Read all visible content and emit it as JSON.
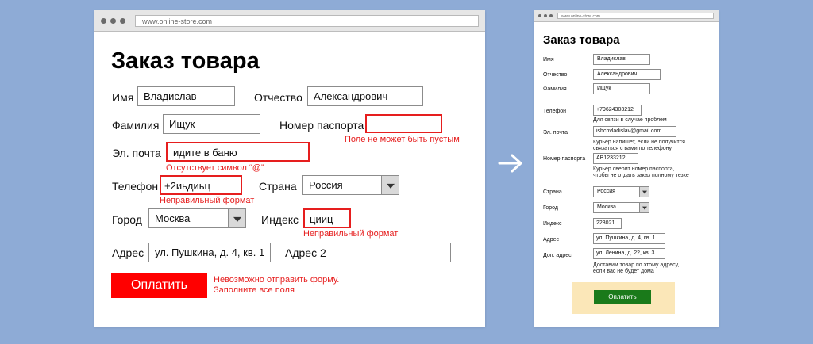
{
  "left_window": {
    "url": "www.online-store.com",
    "title": "Заказ товара",
    "fields": {
      "name": {
        "label": "Имя",
        "value": "Владислав"
      },
      "patronymic": {
        "label": "Отчество",
        "value": "Александрович"
      },
      "surname": {
        "label": "Фамилия",
        "value": "Ищук"
      },
      "passport": {
        "label": "Номер паспорта",
        "value": "",
        "error": "Поле не может быть пустым"
      },
      "email": {
        "label": "Эл. почта",
        "value": "идите в баню",
        "error": "Отсутствует символ “@”"
      },
      "phone": {
        "label": "Телефон",
        "value": "+2иьдиьц",
        "error": "Неправильный формат"
      },
      "country": {
        "label": "Страна",
        "value": "Россия"
      },
      "city": {
        "label": "Город",
        "value": "Москва"
      },
      "zip": {
        "label": "Индекс",
        "value": "цииц",
        "error": "Неправильный формат"
      },
      "address": {
        "label": "Адрес",
        "value": "ул. Пушкина, д. 4, кв. 1"
      },
      "address2": {
        "label": "Адрес 2",
        "value": ""
      }
    },
    "submit_label": "Оплатить",
    "submit_error_1": "Невозможно отправить форму.",
    "submit_error_2": "Заполните все поля"
  },
  "right_window": {
    "url": "www.online-store.com",
    "title": "Заказ товара",
    "fields": {
      "name": {
        "label": "Имя",
        "value": "Владислав"
      },
      "patronymic": {
        "label": "Отчество",
        "value": "Александрович"
      },
      "surname": {
        "label": "Фамилия",
        "value": "Ищук"
      },
      "phone": {
        "label": "Телефон",
        "value": "+79624303212",
        "hint": "Для связи в случае проблем"
      },
      "email": {
        "label": "Эл. почта",
        "value": "ishchvladislav@gmail.com",
        "hint_1": "Курьер напишет, если не получится",
        "hint_2": "связаться с вами по телефону"
      },
      "passport": {
        "label": "Номер паспорта",
        "value": "AB1233212",
        "hint_1": "Курьер сверит номер паспорта,",
        "hint_2": "чтобы не отдать заказ полному тезке"
      },
      "country": {
        "label": "Страна",
        "value": "Россия"
      },
      "city": {
        "label": "Город",
        "value": "Москва"
      },
      "zip": {
        "label": "Индекс",
        "value": "223021"
      },
      "address": {
        "label": "Адрес",
        "value": "ул. Пушкина, д. 4, кв. 1"
      },
      "address2": {
        "label": "Доп. адрес",
        "value": "ул. Ленина, д. 22, кв. 3",
        "hint_1": "Доставим товар по этому адресу,",
        "hint_2": "если вас не будет дома"
      }
    },
    "submit_label": "Оплатить"
  },
  "arrow_icon": "right-arrow-icon",
  "colors": {
    "background": "#8eabd6",
    "error": "#e61e1e",
    "submit_bad": "#ff0000",
    "submit_good": "#1a7a1a",
    "submit_area": "#fbe7b8"
  }
}
